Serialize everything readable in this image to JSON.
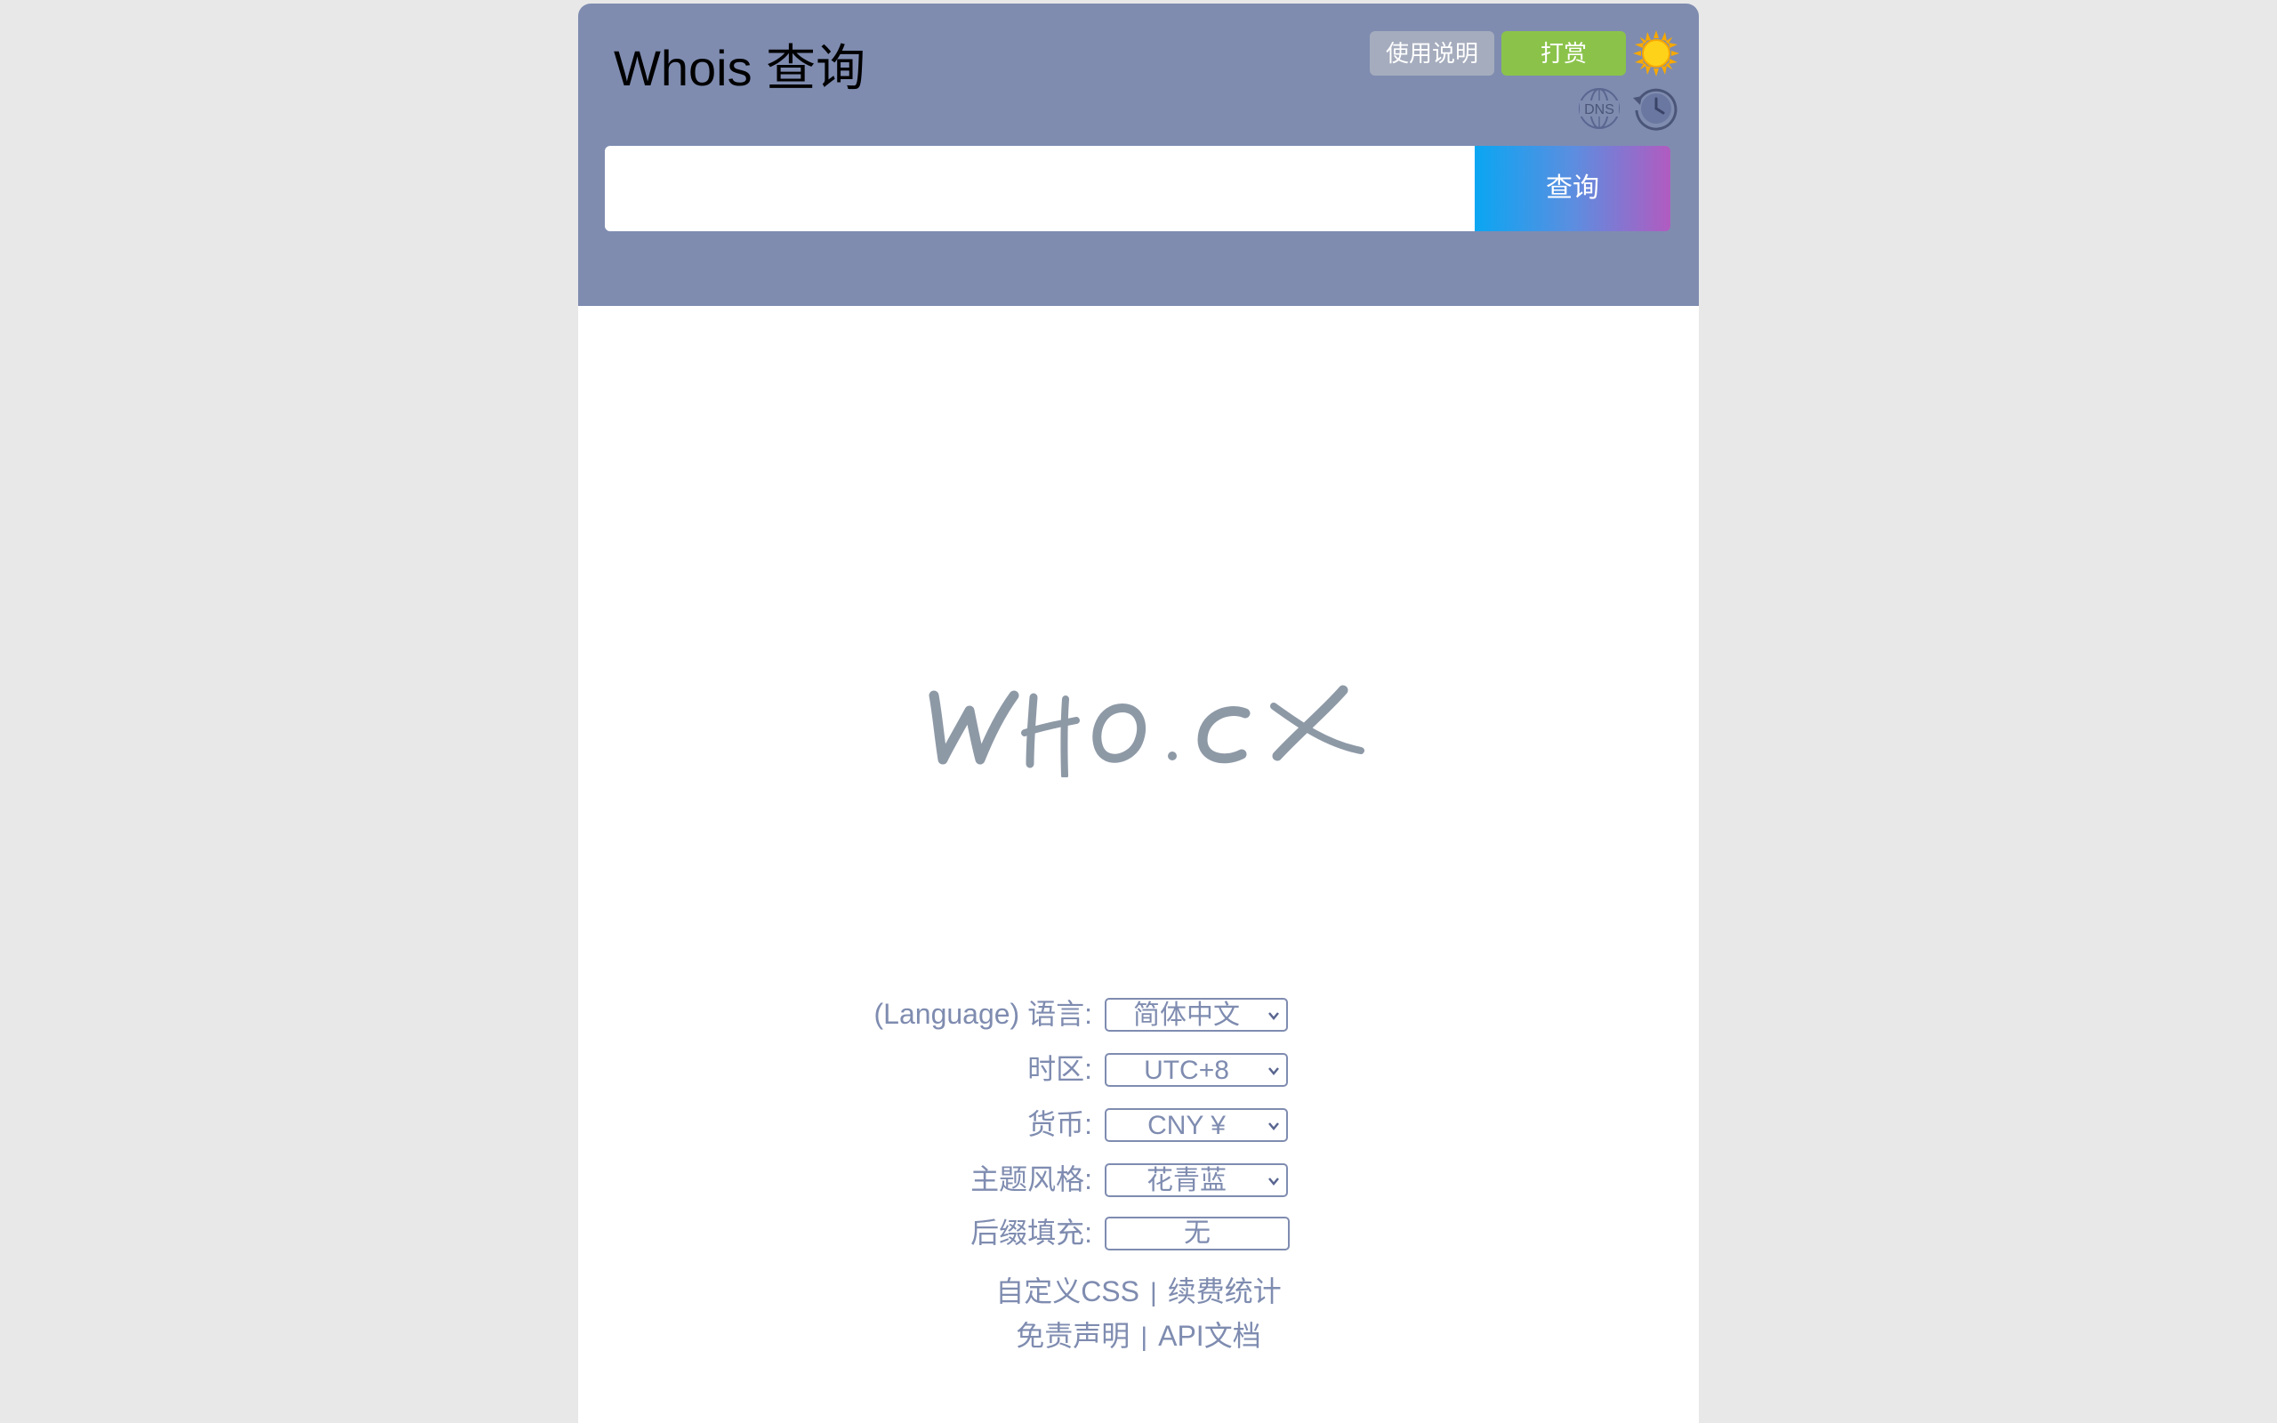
{
  "header": {
    "title": "Whois 查询",
    "help_button": "使用说明",
    "donate_button": "打赏",
    "theme_icon": "sun-icon",
    "dns_icon": "dns-globe-icon",
    "history_icon": "history-clock-icon",
    "dns_label": "DNS"
  },
  "search": {
    "value": "",
    "placeholder": "",
    "button_label": "查询"
  },
  "logo": {
    "text": "WHO.CX"
  },
  "settings": {
    "language": {
      "label": "(Language) 语言:",
      "value": "简体中文"
    },
    "timezone": {
      "label": "时区:",
      "value": "UTC+8"
    },
    "currency": {
      "label": "货币:",
      "value": "CNY ¥"
    },
    "theme": {
      "label": "主题风格:",
      "value": "花青蓝"
    },
    "suffix": {
      "label": "后缀填充:",
      "value": "无"
    }
  },
  "footer_links": {
    "custom_css": "自定义CSS",
    "renewal_stats": "续费统计",
    "disclaimer": "免责声明",
    "api_docs": "API文档",
    "separator": "|"
  },
  "colors": {
    "header_bg": "#7f8cb0",
    "donate_green": "#8bc34a",
    "help_gray": "#a5acbd",
    "text_accent": "#7f8cb0",
    "logo_gray": "#8e99a6"
  }
}
